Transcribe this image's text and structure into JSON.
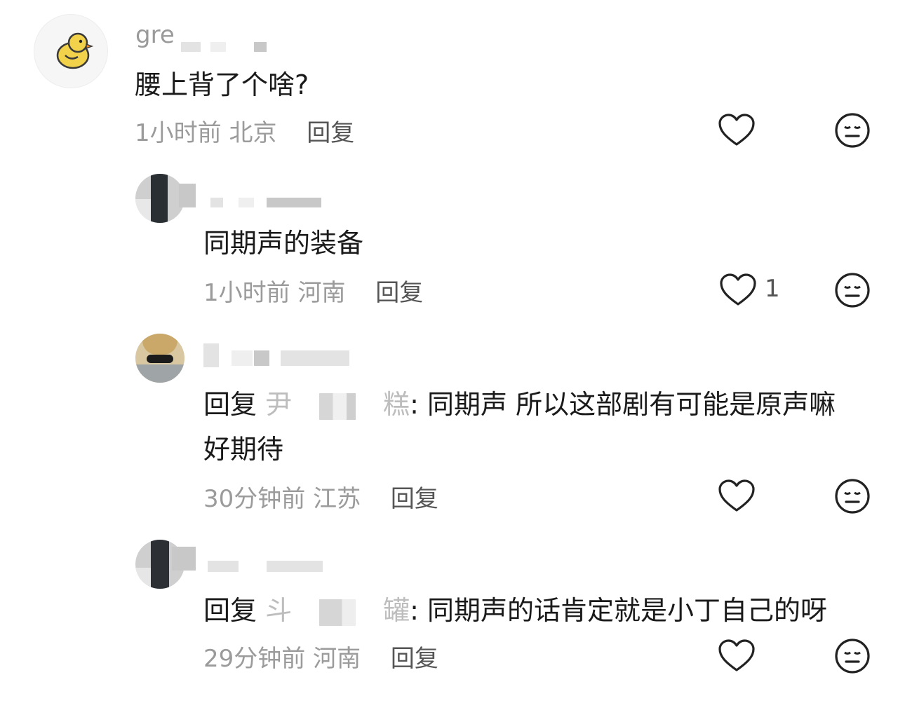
{
  "comments": [
    {
      "username": "gre",
      "text": "腰上背了个啥?",
      "time": "1小时前",
      "location": "北京",
      "reply_label": "回复",
      "likes": ""
    },
    {
      "username": "",
      "text": "同期声的装备",
      "time": "1小时前",
      "location": "河南",
      "reply_label": "回复",
      "likes": "1"
    },
    {
      "username": "",
      "reply_prefix": "回复",
      "reply_target_partial_start": "尹",
      "reply_target_partial_end": "糕",
      "text": ": 同期声 所以这部剧有可能是原声嘛",
      "text_line2": "好期待",
      "time": "30分钟前",
      "location": "江苏",
      "reply_label": "回复",
      "likes": ""
    },
    {
      "username": "",
      "reply_prefix": "回复",
      "reply_target_partial_start": "斗",
      "reply_target_partial_end": "罐",
      "text": ": 同期声的话肯定就是小丁自己的呀",
      "time": "29分钟前",
      "location": "河南",
      "reply_label": "回复",
      "likes": ""
    }
  ],
  "icons": {
    "like": "heart-outline-icon",
    "dislike": "meh-face-icon",
    "avatar_top": "duck-avatar"
  },
  "colors": {
    "text": "#1a1a1a",
    "meta": "#9b9b9b",
    "reply": "#555555",
    "icon_stroke": "#222222",
    "duck": "#f2d24b"
  }
}
